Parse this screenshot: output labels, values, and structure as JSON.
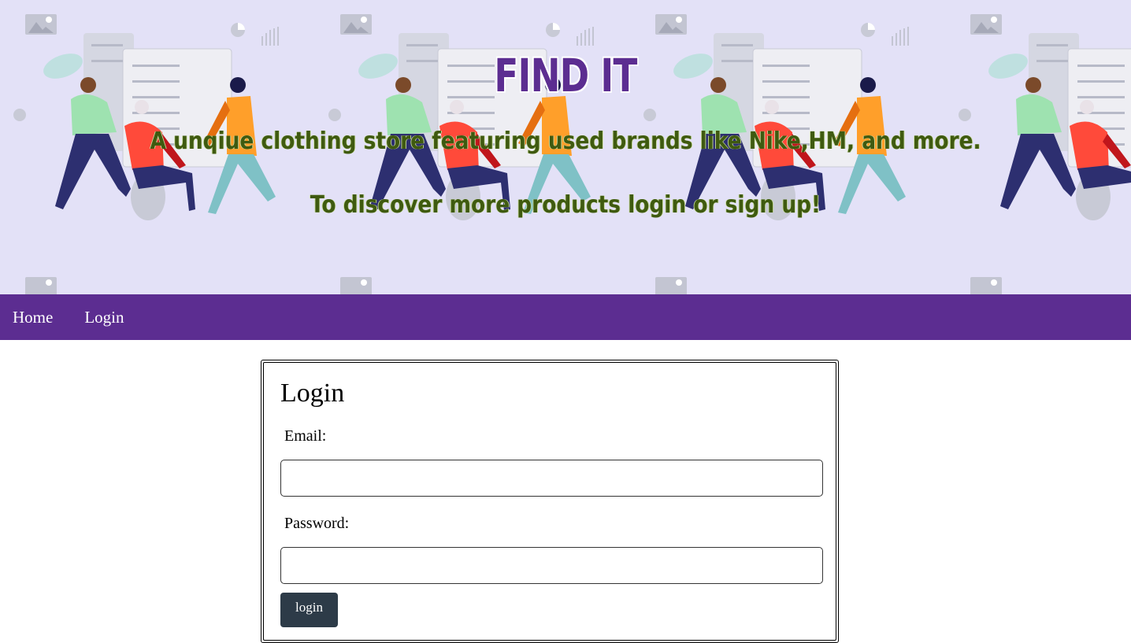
{
  "hero": {
    "title": "FIND IT",
    "subtitle": "A unqiue clothing store featuring used brands like Nike,HM, and more.",
    "cta_text": "To discover more products login or sign up!"
  },
  "nav": {
    "items": [
      {
        "label": "Home"
      },
      {
        "label": "Login"
      }
    ]
  },
  "login_form": {
    "title": "Login",
    "email_label": "Email:",
    "email_value": "",
    "password_label": "Password:",
    "password_value": "",
    "submit_label": "login"
  },
  "colors": {
    "hero_bg": "#e3e1f7",
    "brand_purple": "#5c2d91",
    "subtitle_green": "#3f5a10",
    "button_dark": "#2d3b48"
  },
  "icons": [
    "people-running-illustration",
    "image-placeholder-icon",
    "pie-chart-icon",
    "bar-chart-icon"
  ]
}
